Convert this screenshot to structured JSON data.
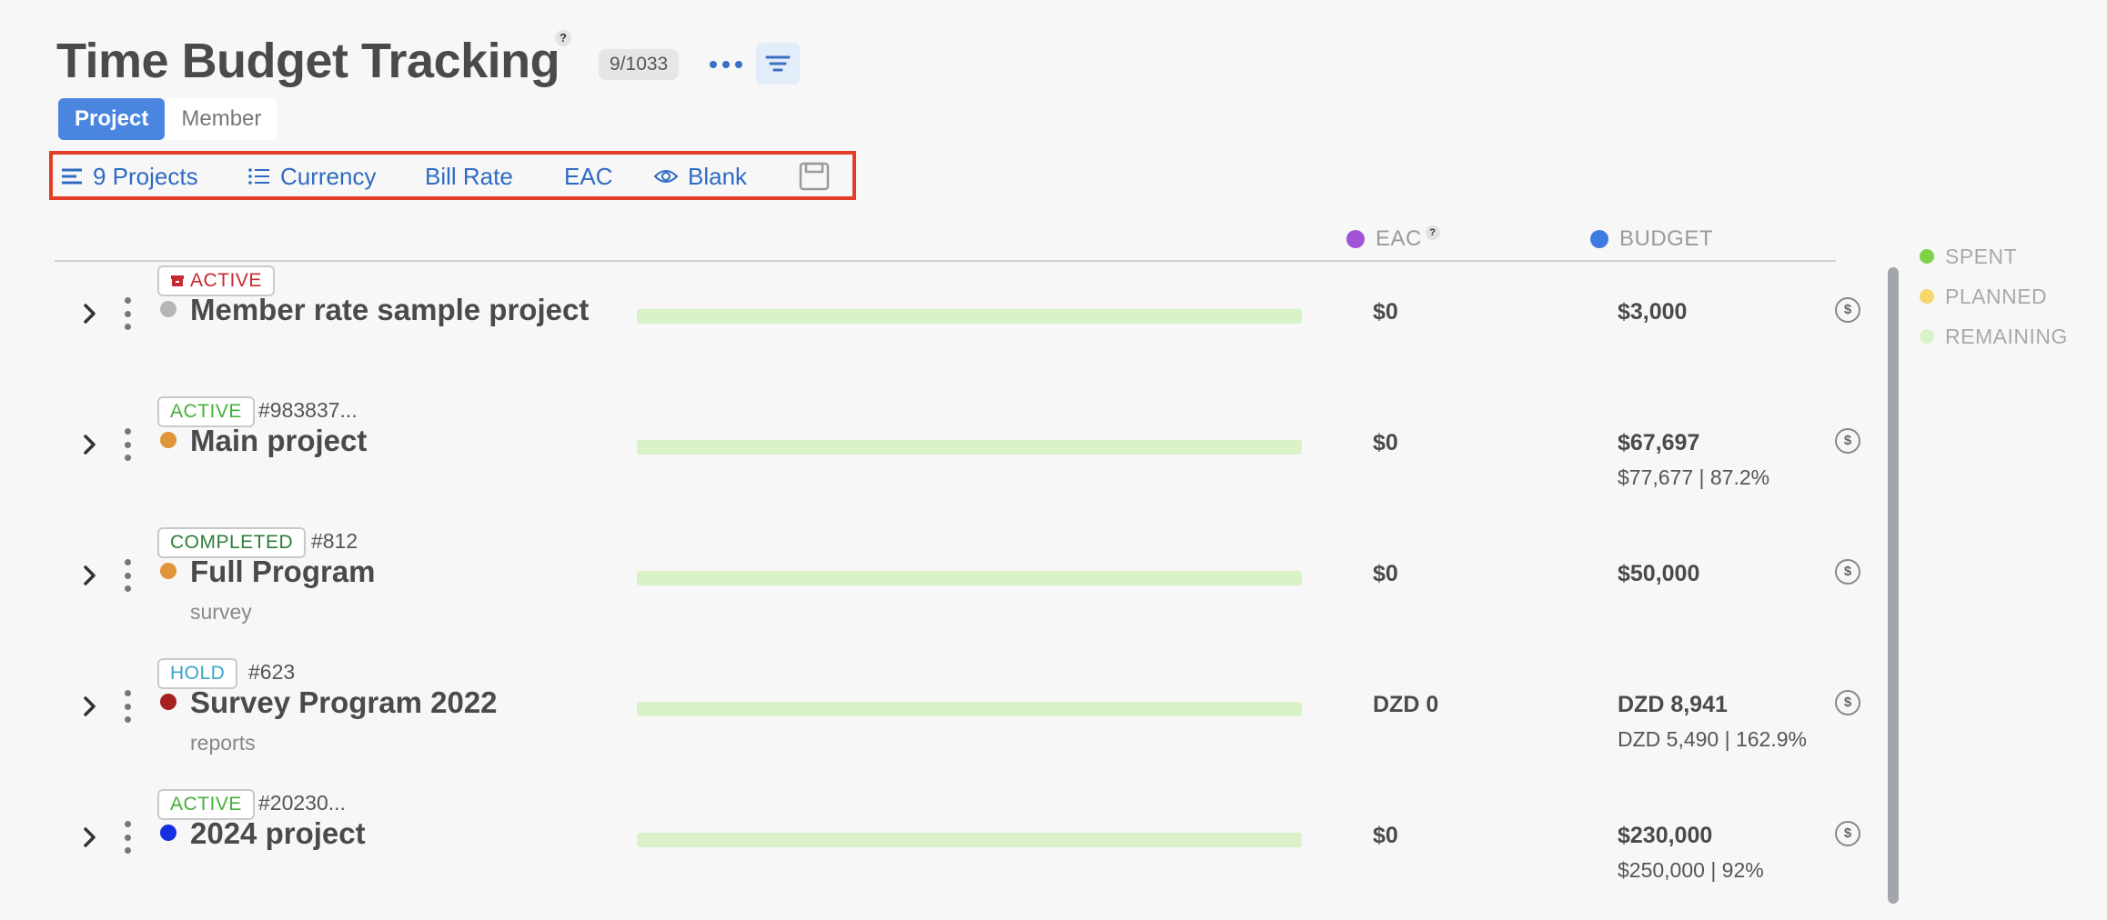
{
  "header": {
    "title": "Time Budget Tracking",
    "help": "?",
    "count_badge": "9/1033",
    "more_icon": "more-horizontal-icon",
    "filter_icon": "filter-lines-icon"
  },
  "view_tabs": [
    {
      "label": "Project",
      "active": true
    },
    {
      "label": "Member",
      "active": false
    }
  ],
  "toolbar": {
    "projects_label": "9 Projects",
    "currency_label": "Currency",
    "bill_rate_label": "Bill Rate",
    "eac_label": "EAC",
    "blank_label": "Blank",
    "save_icon": "save-floppy-icon"
  },
  "columns": {
    "eac": {
      "label": "EAC",
      "help": "?",
      "color": "#a152d6"
    },
    "budget": {
      "label": "BUDGET",
      "color": "#3e7be0"
    }
  },
  "legend": [
    {
      "label": "SPENT",
      "color": "#7ed348"
    },
    {
      "label": "PLANNED",
      "color": "#f6d76a"
    },
    {
      "label": "REMAINING",
      "color": "#d9f2c8"
    }
  ],
  "rows": [
    {
      "status": "ACTIVE",
      "id": "",
      "name": "Member rate sample project",
      "sub": "",
      "dot_color": "#b5b5b5",
      "eac": "$0",
      "budget": "$3,000",
      "budget_sub": "",
      "remaining": 1.0
    },
    {
      "status": "ACTIVE",
      "id": "#983837...",
      "name": "Main project",
      "sub": "",
      "dot_color": "#e0953a",
      "eac": "$0",
      "budget": "$67,697",
      "budget_sub": "$77,677 | 87.2%",
      "remaining": 1.0
    },
    {
      "status": "COMPLETED",
      "id": "#812",
      "name": "Full Program",
      "sub": "survey",
      "dot_color": "#e0953a",
      "eac": "$0",
      "budget": "$50,000",
      "budget_sub": "",
      "remaining": 1.0
    },
    {
      "status": "HOLD",
      "id": "#623",
      "name": "Survey Program 2022",
      "sub": "reports",
      "dot_color": "#a8211e",
      "eac": "DZD 0",
      "budget": "DZD 8,941",
      "budget_sub": "DZD 5,490 | 162.9%",
      "remaining": 1.0
    },
    {
      "status": "ACTIVE",
      "id": "#20230...",
      "name": "2024 project",
      "sub": "",
      "dot_color": "#1530e0",
      "eac": "$0",
      "budget": "$230,000",
      "budget_sub": "$250,000 | 92%",
      "remaining": 1.0
    }
  ],
  "dollar_icon_text": "$"
}
